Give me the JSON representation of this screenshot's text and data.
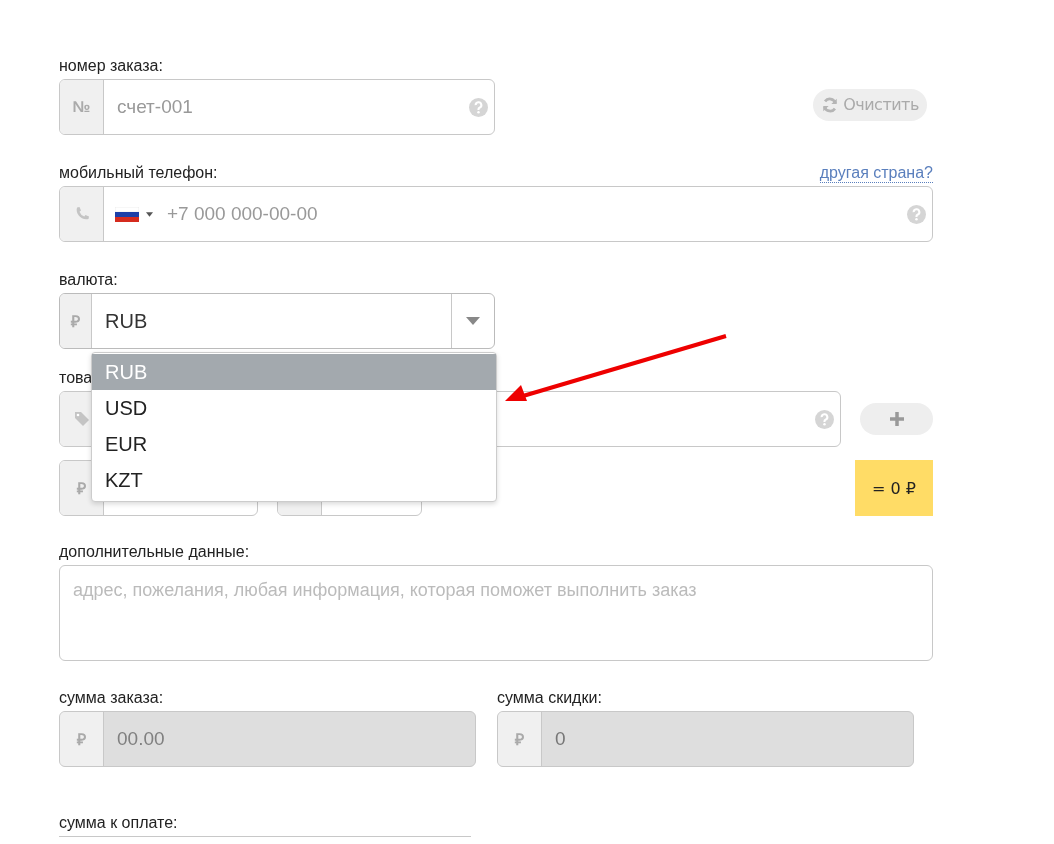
{
  "order_number": {
    "label": "номер заказа:",
    "prefix": "№",
    "placeholder": "счет-001"
  },
  "clear_button": {
    "label": "Очистить"
  },
  "phone": {
    "label": "мобильный телефон:",
    "other_country_link": "другая страна?",
    "placeholder": "+7 000 000-00-00"
  },
  "currency": {
    "label": "валюта:",
    "prefix": "₽",
    "value": "RUB",
    "expanded": true,
    "options": [
      {
        "label": "RUB",
        "selected": true
      },
      {
        "label": "USD",
        "selected": false
      },
      {
        "label": "EUR",
        "selected": false
      },
      {
        "label": "KZT",
        "selected": false
      }
    ]
  },
  "product": {
    "label": "това"
  },
  "price": {
    "prefix": "₽"
  },
  "total": "= 0 ₽",
  "additional": {
    "label": "дополнительные данные:",
    "placeholder": "адрес, пожелания, любая информация, которая поможет выполнить заказ"
  },
  "order_sum": {
    "label": "сумма заказа:",
    "prefix": "₽",
    "placeholder": "00.00",
    "disabled": true
  },
  "discount": {
    "label": "сумма скидки:",
    "prefix": "₽",
    "value": "0",
    "disabled": true
  },
  "amount_due": {
    "label": "сумма к оплате:"
  }
}
